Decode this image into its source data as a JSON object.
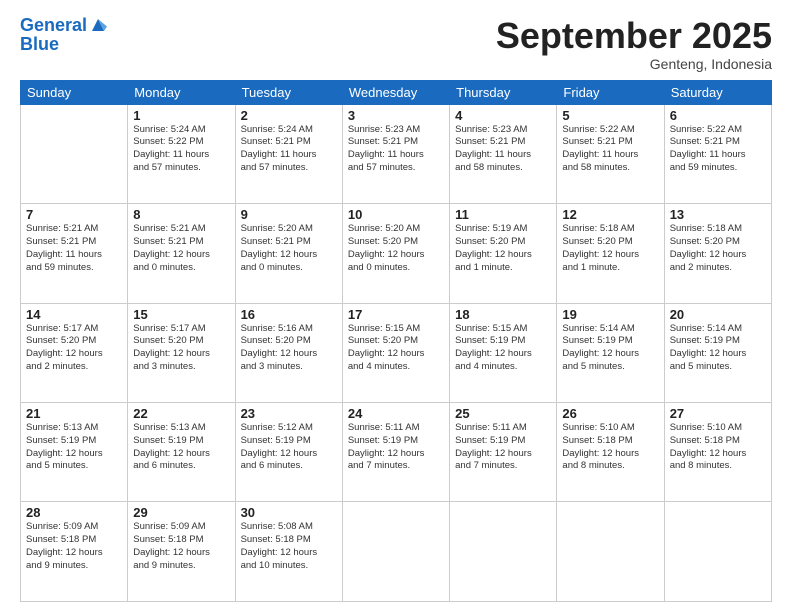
{
  "header": {
    "logo_line1": "General",
    "logo_line2": "Blue",
    "month": "September 2025",
    "location": "Genteng, Indonesia"
  },
  "weekdays": [
    "Sunday",
    "Monday",
    "Tuesday",
    "Wednesday",
    "Thursday",
    "Friday",
    "Saturday"
  ],
  "weeks": [
    [
      {
        "day": "",
        "info": ""
      },
      {
        "day": "1",
        "info": "Sunrise: 5:24 AM\nSunset: 5:22 PM\nDaylight: 11 hours\nand 57 minutes."
      },
      {
        "day": "2",
        "info": "Sunrise: 5:24 AM\nSunset: 5:21 PM\nDaylight: 11 hours\nand 57 minutes."
      },
      {
        "day": "3",
        "info": "Sunrise: 5:23 AM\nSunset: 5:21 PM\nDaylight: 11 hours\nand 57 minutes."
      },
      {
        "day": "4",
        "info": "Sunrise: 5:23 AM\nSunset: 5:21 PM\nDaylight: 11 hours\nand 58 minutes."
      },
      {
        "day": "5",
        "info": "Sunrise: 5:22 AM\nSunset: 5:21 PM\nDaylight: 11 hours\nand 58 minutes."
      },
      {
        "day": "6",
        "info": "Sunrise: 5:22 AM\nSunset: 5:21 PM\nDaylight: 11 hours\nand 59 minutes."
      }
    ],
    [
      {
        "day": "7",
        "info": "Sunrise: 5:21 AM\nSunset: 5:21 PM\nDaylight: 11 hours\nand 59 minutes."
      },
      {
        "day": "8",
        "info": "Sunrise: 5:21 AM\nSunset: 5:21 PM\nDaylight: 12 hours\nand 0 minutes."
      },
      {
        "day": "9",
        "info": "Sunrise: 5:20 AM\nSunset: 5:21 PM\nDaylight: 12 hours\nand 0 minutes."
      },
      {
        "day": "10",
        "info": "Sunrise: 5:20 AM\nSunset: 5:20 PM\nDaylight: 12 hours\nand 0 minutes."
      },
      {
        "day": "11",
        "info": "Sunrise: 5:19 AM\nSunset: 5:20 PM\nDaylight: 12 hours\nand 1 minute."
      },
      {
        "day": "12",
        "info": "Sunrise: 5:18 AM\nSunset: 5:20 PM\nDaylight: 12 hours\nand 1 minute."
      },
      {
        "day": "13",
        "info": "Sunrise: 5:18 AM\nSunset: 5:20 PM\nDaylight: 12 hours\nand 2 minutes."
      }
    ],
    [
      {
        "day": "14",
        "info": "Sunrise: 5:17 AM\nSunset: 5:20 PM\nDaylight: 12 hours\nand 2 minutes."
      },
      {
        "day": "15",
        "info": "Sunrise: 5:17 AM\nSunset: 5:20 PM\nDaylight: 12 hours\nand 3 minutes."
      },
      {
        "day": "16",
        "info": "Sunrise: 5:16 AM\nSunset: 5:20 PM\nDaylight: 12 hours\nand 3 minutes."
      },
      {
        "day": "17",
        "info": "Sunrise: 5:15 AM\nSunset: 5:20 PM\nDaylight: 12 hours\nand 4 minutes."
      },
      {
        "day": "18",
        "info": "Sunrise: 5:15 AM\nSunset: 5:19 PM\nDaylight: 12 hours\nand 4 minutes."
      },
      {
        "day": "19",
        "info": "Sunrise: 5:14 AM\nSunset: 5:19 PM\nDaylight: 12 hours\nand 5 minutes."
      },
      {
        "day": "20",
        "info": "Sunrise: 5:14 AM\nSunset: 5:19 PM\nDaylight: 12 hours\nand 5 minutes."
      }
    ],
    [
      {
        "day": "21",
        "info": "Sunrise: 5:13 AM\nSunset: 5:19 PM\nDaylight: 12 hours\nand 5 minutes."
      },
      {
        "day": "22",
        "info": "Sunrise: 5:13 AM\nSunset: 5:19 PM\nDaylight: 12 hours\nand 6 minutes."
      },
      {
        "day": "23",
        "info": "Sunrise: 5:12 AM\nSunset: 5:19 PM\nDaylight: 12 hours\nand 6 minutes."
      },
      {
        "day": "24",
        "info": "Sunrise: 5:11 AM\nSunset: 5:19 PM\nDaylight: 12 hours\nand 7 minutes."
      },
      {
        "day": "25",
        "info": "Sunrise: 5:11 AM\nSunset: 5:19 PM\nDaylight: 12 hours\nand 7 minutes."
      },
      {
        "day": "26",
        "info": "Sunrise: 5:10 AM\nSunset: 5:18 PM\nDaylight: 12 hours\nand 8 minutes."
      },
      {
        "day": "27",
        "info": "Sunrise: 5:10 AM\nSunset: 5:18 PM\nDaylight: 12 hours\nand 8 minutes."
      }
    ],
    [
      {
        "day": "28",
        "info": "Sunrise: 5:09 AM\nSunset: 5:18 PM\nDaylight: 12 hours\nand 9 minutes."
      },
      {
        "day": "29",
        "info": "Sunrise: 5:09 AM\nSunset: 5:18 PM\nDaylight: 12 hours\nand 9 minutes."
      },
      {
        "day": "30",
        "info": "Sunrise: 5:08 AM\nSunset: 5:18 PM\nDaylight: 12 hours\nand 10 minutes."
      },
      {
        "day": "",
        "info": ""
      },
      {
        "day": "",
        "info": ""
      },
      {
        "day": "",
        "info": ""
      },
      {
        "day": "",
        "info": ""
      }
    ]
  ]
}
